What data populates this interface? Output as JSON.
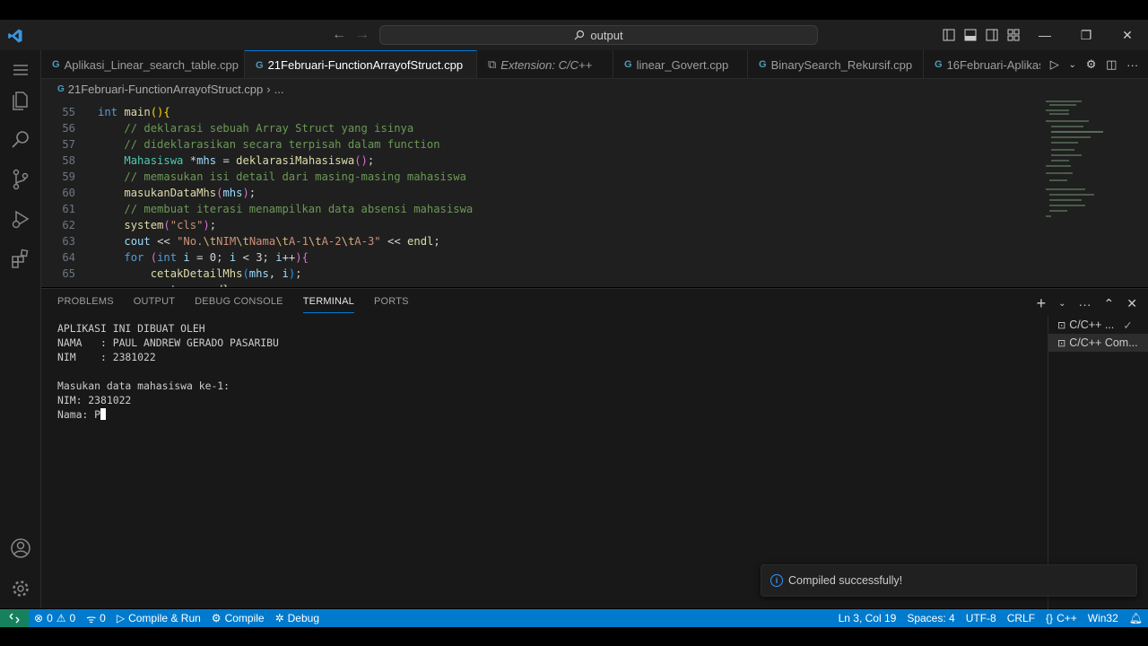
{
  "titlebar": {
    "search_text": "output"
  },
  "tabs": [
    {
      "label": "Aplikasi_Linear_search_table.cpp",
      "icon": "cpp",
      "active": false
    },
    {
      "label": "21Februari-FunctionArrayofStruct.cpp",
      "icon": "cpp",
      "active": true
    },
    {
      "label": "Extension: C/C++",
      "icon": "extension",
      "active": false
    },
    {
      "label": "linear_Govert.cpp",
      "icon": "cpp",
      "active": false
    },
    {
      "label": "BinarySearch_Rekursif.cpp",
      "icon": "cpp",
      "active": false
    },
    {
      "label": "16Februari-Aplikas",
      "icon": "cpp",
      "active": false
    }
  ],
  "breadcrumb": {
    "file": "21Februari-FunctionArrayofStruct.cpp",
    "rest": "..."
  },
  "code_lines": [
    {
      "n": "55"
    },
    {
      "n": "56"
    },
    {
      "n": "57"
    },
    {
      "n": "58"
    },
    {
      "n": "59"
    },
    {
      "n": "60"
    },
    {
      "n": "61"
    },
    {
      "n": "62"
    },
    {
      "n": "63"
    },
    {
      "n": "64"
    },
    {
      "n": "65"
    }
  ],
  "panel": {
    "tabs": [
      "PROBLEMS",
      "OUTPUT",
      "DEBUG CONSOLE",
      "TERMINAL",
      "PORTS"
    ],
    "active_tab": "TERMINAL",
    "terminal_lines": [
      "APLIKASI INI DIBUAT OLEH",
      "NAMA   : PAUL ANDREW GERADO PASARIBU",
      "NIM    : 2381022",
      "",
      "Masukan data mahasiswa ke-1:",
      "NIM: 2381022"
    ],
    "prompt_line": "Nama: ",
    "prompt_input": "P",
    "terminals": [
      "C/C++ ...",
      "C/C++ Com..."
    ]
  },
  "toast": {
    "message": "Compiled successfully!"
  },
  "statusbar": {
    "errors": "0",
    "warnings": "0",
    "info": "0",
    "compile_run": "Compile & Run",
    "compile": "Compile",
    "debug": "Debug",
    "position": "Ln 3, Col 19",
    "spaces": "Spaces: 4",
    "encoding": "UTF-8",
    "eol": "CRLF",
    "language": "C++",
    "platform": "Win32"
  },
  "colors": {
    "accent": "#0078d4",
    "statusbar": "#007acc",
    "remote": "#16825d"
  }
}
